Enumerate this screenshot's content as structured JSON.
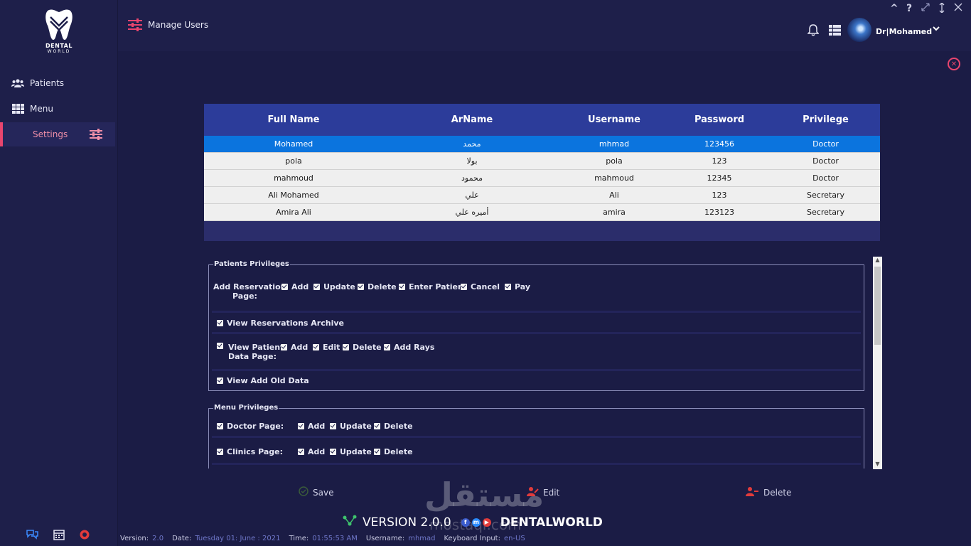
{
  "sidebar": {
    "logo_line1": "DENTAL",
    "logo_line2": "WORLD",
    "items": [
      {
        "label": "Patients",
        "icon": "users-icon"
      },
      {
        "label": "Menu",
        "icon": "grid-icon"
      },
      {
        "label": "Settings",
        "icon": "sliders-icon",
        "active": true
      }
    ]
  },
  "header": {
    "title": "Manage Users",
    "user_name": "Dr|Mohamed"
  },
  "users_table": {
    "columns": [
      "Full Name",
      "ArName",
      "Username",
      "Password",
      "Privilege"
    ],
    "rows": [
      [
        "Mohamed",
        "محمد",
        "mhmad",
        "123456",
        "Doctor"
      ],
      [
        "pola",
        "بولا",
        "pola",
        "123",
        "Doctor"
      ],
      [
        "mahmoud",
        "محمود",
        "mahmoud",
        "12345",
        "Doctor"
      ],
      [
        "Ali Mohamed",
        "علي",
        "Ali",
        "123",
        "Secretary"
      ],
      [
        "Amira Ali",
        "أميره علي",
        "amira",
        "123123",
        "Secretary"
      ]
    ],
    "selected_row": 0
  },
  "patients_privileges": {
    "legend": "Patients Privileges",
    "add_reservation_label_1": "Add Reservation",
    "add_reservation_label_2": "Page:",
    "add_reservation": [
      "Add",
      "Update",
      "Delete",
      "Enter Patient",
      "Cancel",
      "Pay"
    ],
    "view_reservations_archive": "View Reservations Archive",
    "view_patient_label_1": "View Patient",
    "view_patient_label_2": "Data Page:",
    "view_patient": [
      "Add",
      "Edit",
      "Delete",
      "Add Rays"
    ],
    "view_add_old_data": "View Add Old Data"
  },
  "menu_privileges": {
    "legend": "Menu Privileges",
    "doctor_page": "Doctor Page:",
    "doctor_page_opts": [
      "Add",
      "Update",
      "Delete"
    ],
    "clinics_page": "Clinics Page:",
    "clinics_page_opts": [
      "Add",
      "Update",
      "Delete"
    ]
  },
  "actions": {
    "save": "Save",
    "edit": "Edit",
    "delete": "Delete"
  },
  "footer": {
    "version": "VERSION 2.0.0",
    "brand": "DENTALWORLD",
    "watermark": "مستقل",
    "watermark_url": "mostaql.com"
  },
  "status": {
    "version_label": "Version:",
    "version_value": "2.0",
    "date_label": "Date:",
    "date_value": "Tuesday 01: June : 2021",
    "time_label": "Time:",
    "time_value": "01:55:53 AM",
    "username_label": "Username:",
    "username_value": "mhmad",
    "keyboard_label": "Keyboard Input:",
    "keyboard_value": "en-US"
  },
  "colors": {
    "background": "#1b1c45",
    "accent_pink": "#e9456e",
    "header_blue": "#2c3c9a",
    "selected_row": "#0b74de"
  }
}
